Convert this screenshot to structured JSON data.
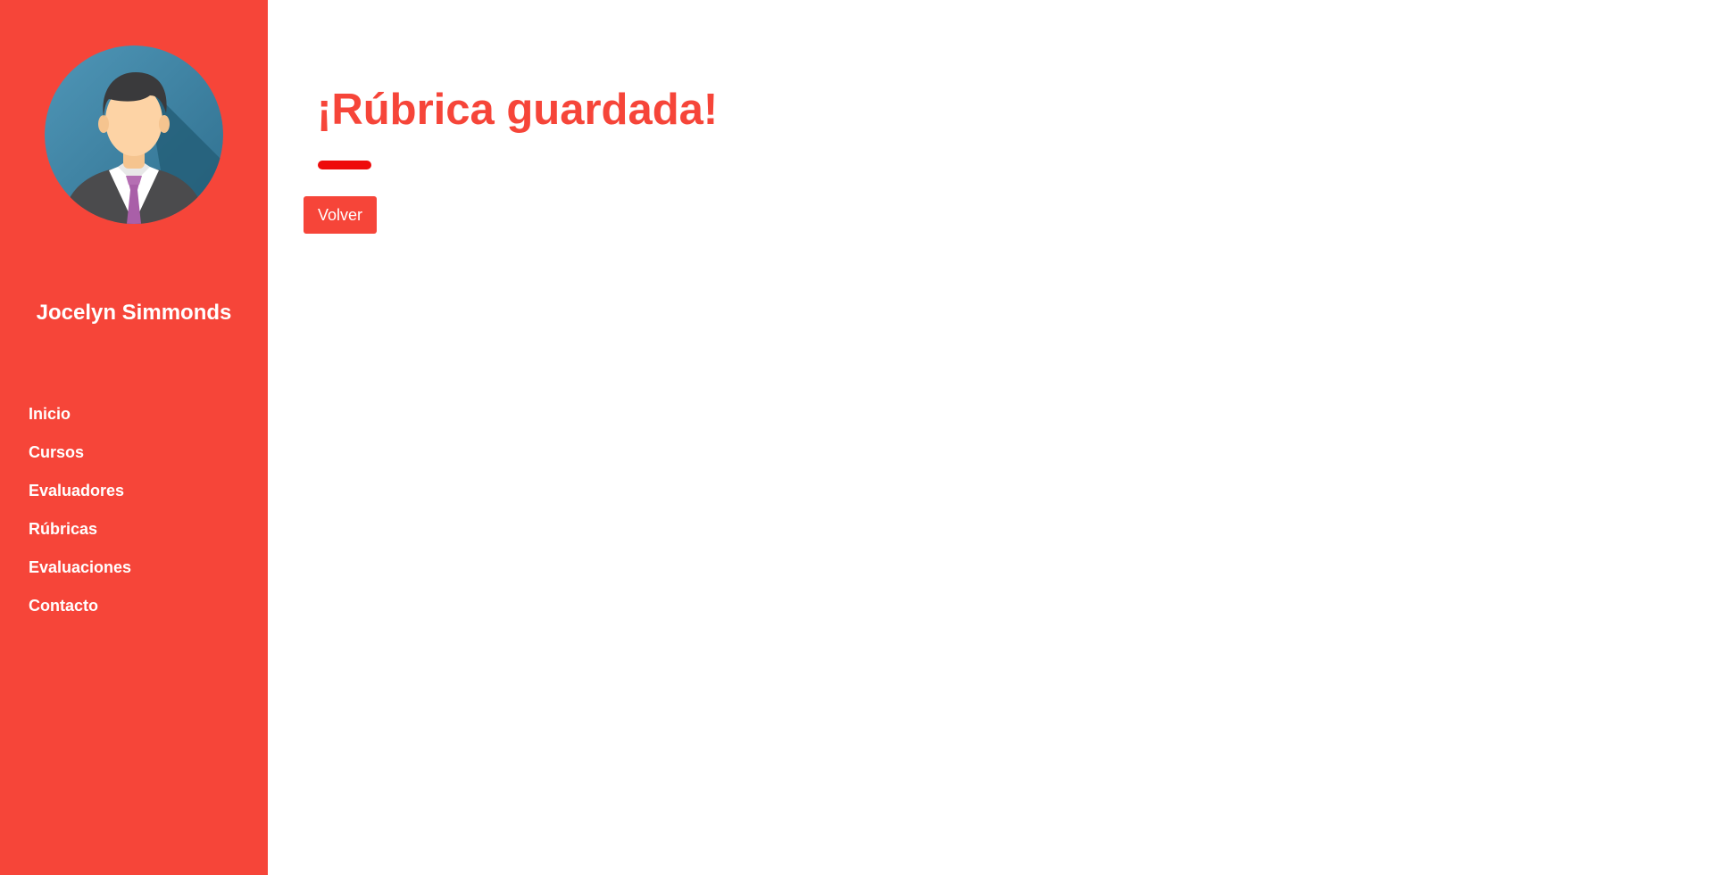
{
  "colors": {
    "accent": "#f64539",
    "divider": "#ee0b0b",
    "background": "#ffffff",
    "sidebar_text": "#ffffff"
  },
  "sidebar": {
    "avatar_icon": "businessman-avatar-icon",
    "user_name": "Jocelyn Simmonds",
    "nav_items": [
      {
        "label": "Inicio"
      },
      {
        "label": "Cursos"
      },
      {
        "label": "Evaluadores"
      },
      {
        "label": "Rúbricas"
      },
      {
        "label": "Evaluaciones"
      },
      {
        "label": "Contacto"
      }
    ]
  },
  "main": {
    "title": "¡Rúbrica guardada!",
    "back_button_label": "Volver"
  }
}
